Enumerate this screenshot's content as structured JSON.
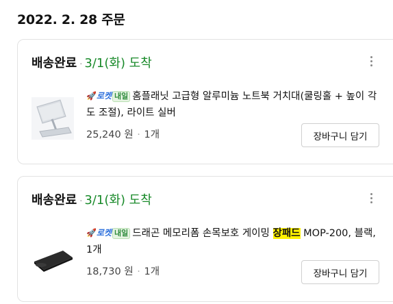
{
  "order_date": "2022. 2. 28 주문",
  "orders": [
    {
      "status": "배송완료",
      "delivery": "3/1(화) 도착",
      "badges": {
        "rocket": "로켓",
        "tomorrow": "내일"
      },
      "title_text": "홈플래닛 고급형 알루미늄 노트북 거치대(쿨링홀 + 높이 각도 조절), 라이트 실버",
      "price": "25,240 원",
      "quantity": "1개",
      "cart_button": "장바구니 담기",
      "thumb_icon": "laptop-stand-image"
    },
    {
      "status": "배송완료",
      "delivery": "3/1(화) 도착",
      "badges": {
        "rocket": "로켓",
        "tomorrow": "내일"
      },
      "title_pre": "드래곤 메모리폼 손목보호 게이밍 ",
      "title_highlight": "장패드",
      "title_post": " MOP-200, 블랙, 1개",
      "price": "18,730 원",
      "quantity": "1개",
      "cart_button": "장바구니 담기",
      "thumb_icon": "mouse-pad-image"
    }
  ],
  "colors": {
    "delivery_green": "#198a2a",
    "rocket_blue": "#2b6fdc",
    "highlight_yellow": "#fff200"
  }
}
